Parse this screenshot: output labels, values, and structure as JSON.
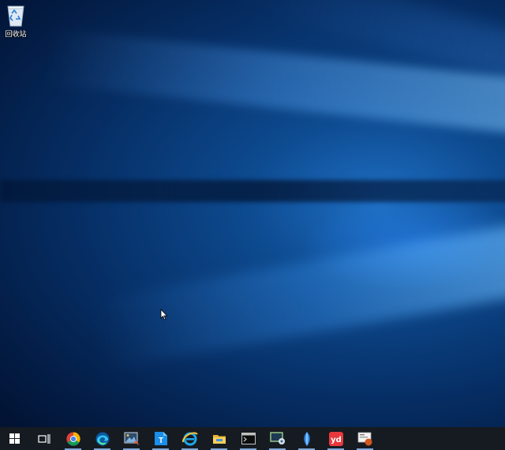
{
  "desktop": {
    "icons": [
      {
        "label": "回收站",
        "icon": "recycle-bin-icon"
      }
    ]
  },
  "taskbar": {
    "start": {
      "icon": "windows-start-icon"
    },
    "task_view": {
      "icon": "task-view-icon"
    },
    "apps": [
      {
        "name": "chrome",
        "icon": "chrome-icon"
      },
      {
        "name": "edge",
        "icon": "edge-icon"
      },
      {
        "name": "screenshot-editor",
        "icon": "image-editor-icon"
      },
      {
        "name": "typora",
        "icon": "typora-icon",
        "letter": "T"
      },
      {
        "name": "internet-explorer",
        "icon": "internet-explorer-icon"
      },
      {
        "name": "file-explorer",
        "icon": "file-explorer-icon"
      },
      {
        "name": "terminal",
        "icon": "terminal-icon"
      },
      {
        "name": "remote-app",
        "icon": "remote-desktop-icon"
      },
      {
        "name": "feather-app",
        "icon": "feather-icon"
      },
      {
        "name": "youdao",
        "icon": "youdao-dictionary-icon",
        "letter": "yd"
      },
      {
        "name": "recorder",
        "icon": "screen-recorder-icon"
      }
    ]
  },
  "colors": {
    "taskbar": "#161b22",
    "accent": "#0078d7",
    "youdao": "#e8383d",
    "typora": "#1a8ee8"
  }
}
